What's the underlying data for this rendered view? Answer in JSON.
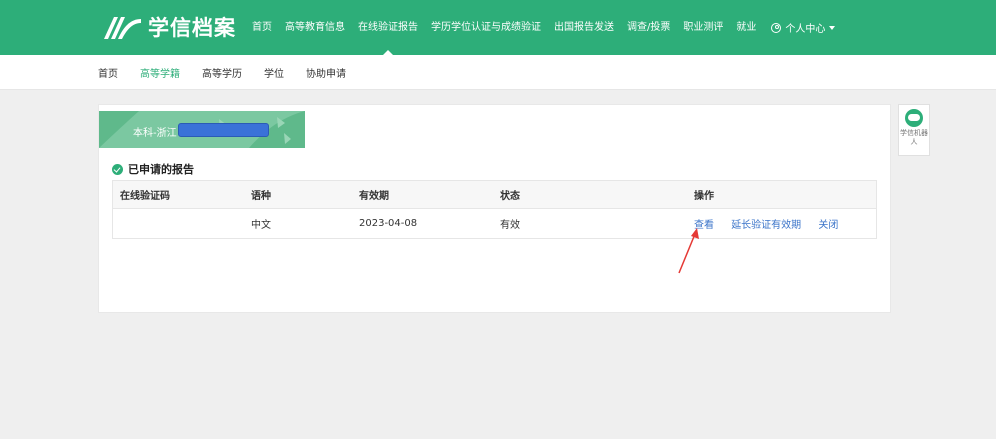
{
  "header": {
    "logo_text": "学信档案",
    "nav": [
      {
        "label": "首页",
        "active": false
      },
      {
        "label": "高等教育信息",
        "active": false
      },
      {
        "label": "在线验证报告",
        "active": true
      },
      {
        "label": "学历学位认证与成绩验证",
        "active": false
      },
      {
        "label": "出国报告发送",
        "active": false
      },
      {
        "label": "调查/投票",
        "active": false
      },
      {
        "label": "职业测评",
        "active": false
      },
      {
        "label": "就业",
        "active": false
      }
    ],
    "user_menu": "个人中心"
  },
  "subnav": [
    "首页",
    "高等学籍",
    "高等学历",
    "学位",
    "协助申请"
  ],
  "subnav_active": "高等学籍",
  "banner": {
    "text": "本科-浙江"
  },
  "section": {
    "title": "已申请的报告"
  },
  "table": {
    "columns": [
      "在线验证码",
      "语种",
      "有效期",
      "状态",
      "操作"
    ],
    "rows": [
      {
        "code": "",
        "language": "中文",
        "valid_until": "2023-04-08",
        "status": "有效",
        "actions": [
          "查看",
          "延长验证有效期",
          "关闭"
        ]
      }
    ]
  },
  "robot": {
    "label": "学信机器人"
  },
  "colors": {
    "brand": "#2dae79",
    "link": "#3b74c9",
    "annotation_arrow": "#e53935"
  }
}
